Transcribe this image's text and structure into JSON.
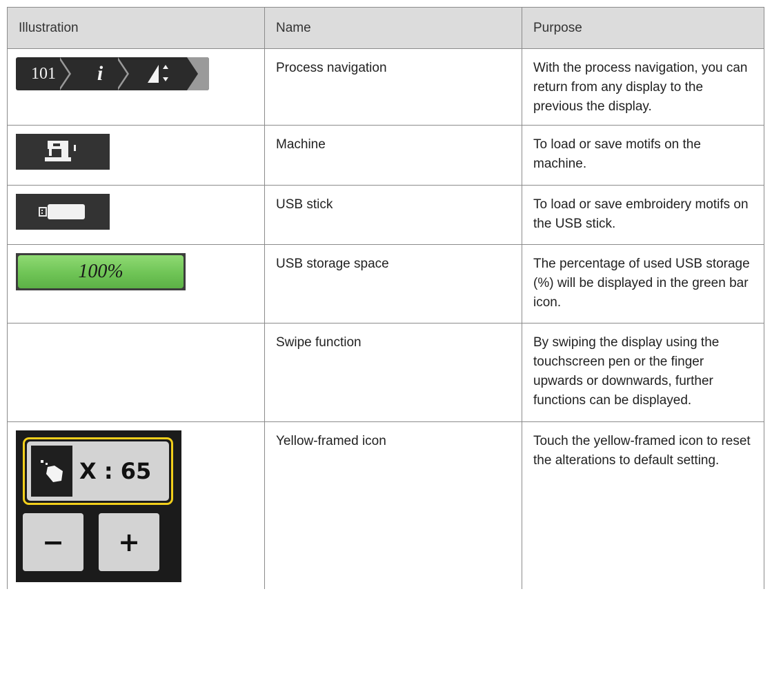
{
  "table": {
    "headers": [
      "Illustration",
      "Name",
      "Purpose"
    ],
    "rows": [
      {
        "name": "Process navigation",
        "purpose": "With the process navigation, you can return from any display to the previous the display.",
        "illustration": {
          "icon": "process-navigation-icon",
          "segments": [
            "101",
            "i",
            "stitch-adjust-icon"
          ]
        }
      },
      {
        "name": "Machine",
        "purpose": "To load or save motifs on the machine.",
        "illustration": {
          "icon": "sewing-machine-icon"
        }
      },
      {
        "name": "USB stick",
        "purpose": "To load or save embroidery motifs on the USB stick.",
        "illustration": {
          "icon": "usb-stick-icon"
        }
      },
      {
        "name": "USB storage space",
        "purpose": "The percentage of used USB storage (%) will be displayed in the green bar icon.",
        "illustration": {
          "icon": "storage-bar-icon",
          "value_text": "100%",
          "fill_percent": 100,
          "color": "#6fc456"
        }
      },
      {
        "name": "Swipe function",
        "purpose": "By swiping the display using the touchscreen pen or the finger upwards or downwards, further functions can be displayed.",
        "illustration": null
      },
      {
        "name": "Yellow-framed icon",
        "purpose": "Touch the yellow-framed icon to reset the alterations to default setting.",
        "illustration": {
          "icon": "yellow-framed-icon",
          "value_text": "X : 65",
          "minus": "−",
          "plus": "+",
          "frame_color": "#f2cf1b"
        }
      }
    ]
  }
}
